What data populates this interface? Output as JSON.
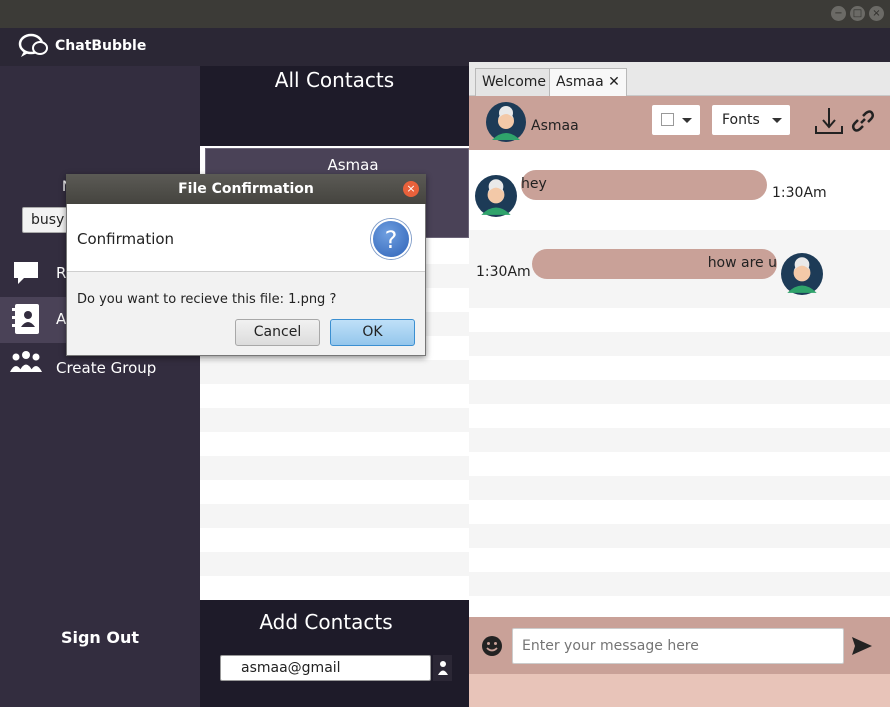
{
  "window": {
    "controls": [
      "−",
      "□",
      "×"
    ]
  },
  "app": {
    "name": "ChatBubble"
  },
  "sidebar": {
    "user_initial": "N",
    "status": "busy",
    "items": [
      {
        "label": "R",
        "icon": "chat-icon"
      },
      {
        "label": "A",
        "icon": "address-book-icon"
      },
      {
        "label": "Create Group",
        "icon": "group-icon"
      }
    ],
    "sign_out": "Sign Out"
  },
  "contacts": {
    "title": "All Contacts",
    "items": [
      {
        "name": "Asmaa"
      }
    ]
  },
  "add_contacts": {
    "title": "Add Contacts",
    "input_value": "asmaa@gmail"
  },
  "chat": {
    "tabs": [
      {
        "label": "Welcome"
      },
      {
        "label": "Asmaa",
        "close": "✕"
      }
    ],
    "header": {
      "name": "Asmaa",
      "font_select": "Fonts"
    },
    "messages": [
      {
        "text": "hey",
        "time": "1:30Am",
        "side": "left"
      },
      {
        "text": "how are u",
        "time": "1:30Am",
        "side": "right"
      }
    ],
    "input_placeholder": "Enter your message here"
  },
  "dialog": {
    "title": "File Confirmation",
    "heading": "Confirmation",
    "message": "Do you want to recieve this file: 1.png ?",
    "cancel_label": "Cancel",
    "ok_label": "OK",
    "icon": "question-icon"
  },
  "colors": {
    "sidebar": "#332d3f",
    "panel_dark": "#1e1b29",
    "chat_accent": "#c9a198",
    "ok_button": "#94c6ec"
  }
}
